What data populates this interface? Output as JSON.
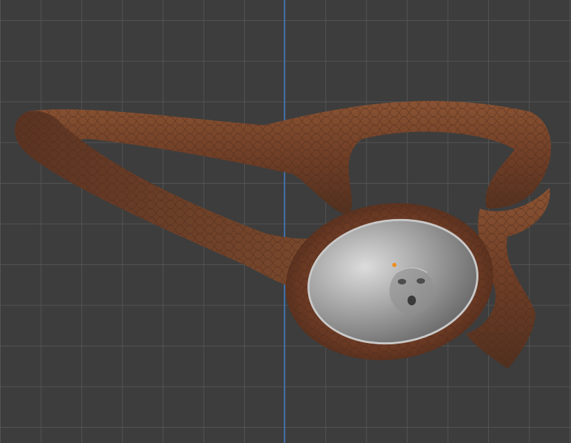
{
  "viewport": {
    "background_color": "#3d3d3d",
    "grid_color": "#545454",
    "y_axis_color": "#3f6fa8",
    "origin_marker_color": "#f08c1e"
  },
  "model": {
    "strap_color": "#6e3d26",
    "strap_highlight": "#8b5232",
    "lens_color": "#9c9c9c",
    "lens_highlight": "#d8d8d8"
  }
}
